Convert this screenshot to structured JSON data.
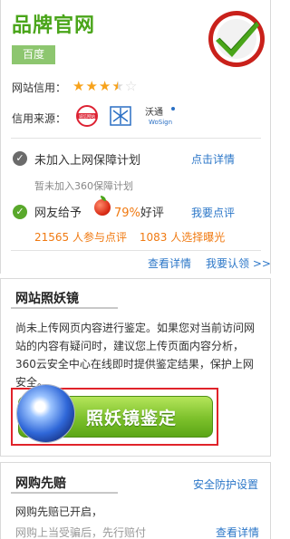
{
  "brand": {
    "title": "品牌官网",
    "tag": "百度"
  },
  "rating": {
    "label": "网站信用：",
    "stars": 3.5
  },
  "credit": {
    "label": "信用来源：",
    "sources": [
      "诚信网站",
      "可信网站",
      "沃通 WoSign"
    ]
  },
  "guarantee": {
    "status": "未加入上网保障计划",
    "link": "点击详情",
    "note": "暂未加入360保障计划"
  },
  "review": {
    "prefix": "网友给予",
    "percent": "79%",
    "suffix": "好评",
    "link": "我要点评",
    "count1": "21565",
    "count1_text": "人参与点评",
    "count2": "1083",
    "count2_text": "人选择曝光"
  },
  "links": {
    "details": "查看详情",
    "report": "我要认领 >>"
  },
  "mirror": {
    "title": "网站照妖镜",
    "description": "尚未上传网页内容进行鉴定。如果您对当前访问网站的内容有疑问时，建议您上传页面内容分析，360云安全中心在线即时提供鉴定结果，保护上网安全。",
    "button": "照妖镜鉴定"
  },
  "compensation": {
    "title": "网购先赔",
    "link": "安全防护设置",
    "line1": "网购先赔已开启，",
    "line2": "网购上当受骗后，先行赔付",
    "details": "查看详情"
  },
  "colors": {
    "brand_green": "#4aa51a",
    "link_blue": "#2c77c8",
    "orange": "#f07a12",
    "alert_red": "#e0232a"
  }
}
